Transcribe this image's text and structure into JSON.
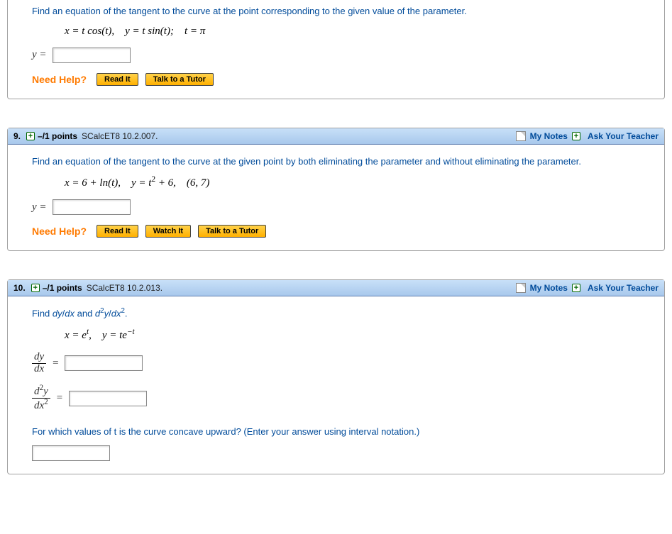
{
  "q8": {
    "prompt": "Find an equation of the tangent to the curve at the point corresponding to the given value of the parameter.",
    "math": "x = t cos(t), y = t sin(t); t = π",
    "answer_lhs": "y =",
    "help": {
      "label": "Need Help?",
      "read": "Read It",
      "talk": "Talk to a Tutor"
    }
  },
  "q9": {
    "number": "9.",
    "plus": "+",
    "points": "–/1 points",
    "ref": "SCalcET8 10.2.007.",
    "notes": "My Notes",
    "ask": "Ask Your Teacher",
    "prompt": "Find an equation of the tangent to the curve at the given point by both eliminating the parameter and without eliminating the parameter.",
    "math_prefix": "x = 6 + ln(t), y = t",
    "math_sup": "2",
    "math_suffix": " + 6, (6, 7)",
    "answer_lhs": "y =",
    "help": {
      "label": "Need Help?",
      "read": "Read It",
      "watch": "Watch It",
      "talk": "Talk to a Tutor"
    }
  },
  "q10": {
    "number": "10.",
    "plus": "+",
    "points": "–/1 points",
    "ref": "SCalcET8 10.2.013.",
    "notes": "My Notes",
    "ask": "Ask Your Teacher",
    "prompt_prefix": "Find ",
    "prompt_mid": " and ",
    "prompt_suffix": ".",
    "dy_dx": {
      "num": "dy",
      "den": "dx"
    },
    "d2y_dx2_num": "d²y",
    "d2y_dx2_den": "dx²",
    "math_x_pre": "x = e",
    "math_x_sup": "t",
    "math_sep": ", ",
    "math_y_pre": "y = te",
    "math_y_sup": "−t",
    "row1_eq": "=",
    "row2_eq": "=",
    "concave_prompt": "For which values of t is the curve concave upward? (Enter your answer using interval notation.)"
  }
}
